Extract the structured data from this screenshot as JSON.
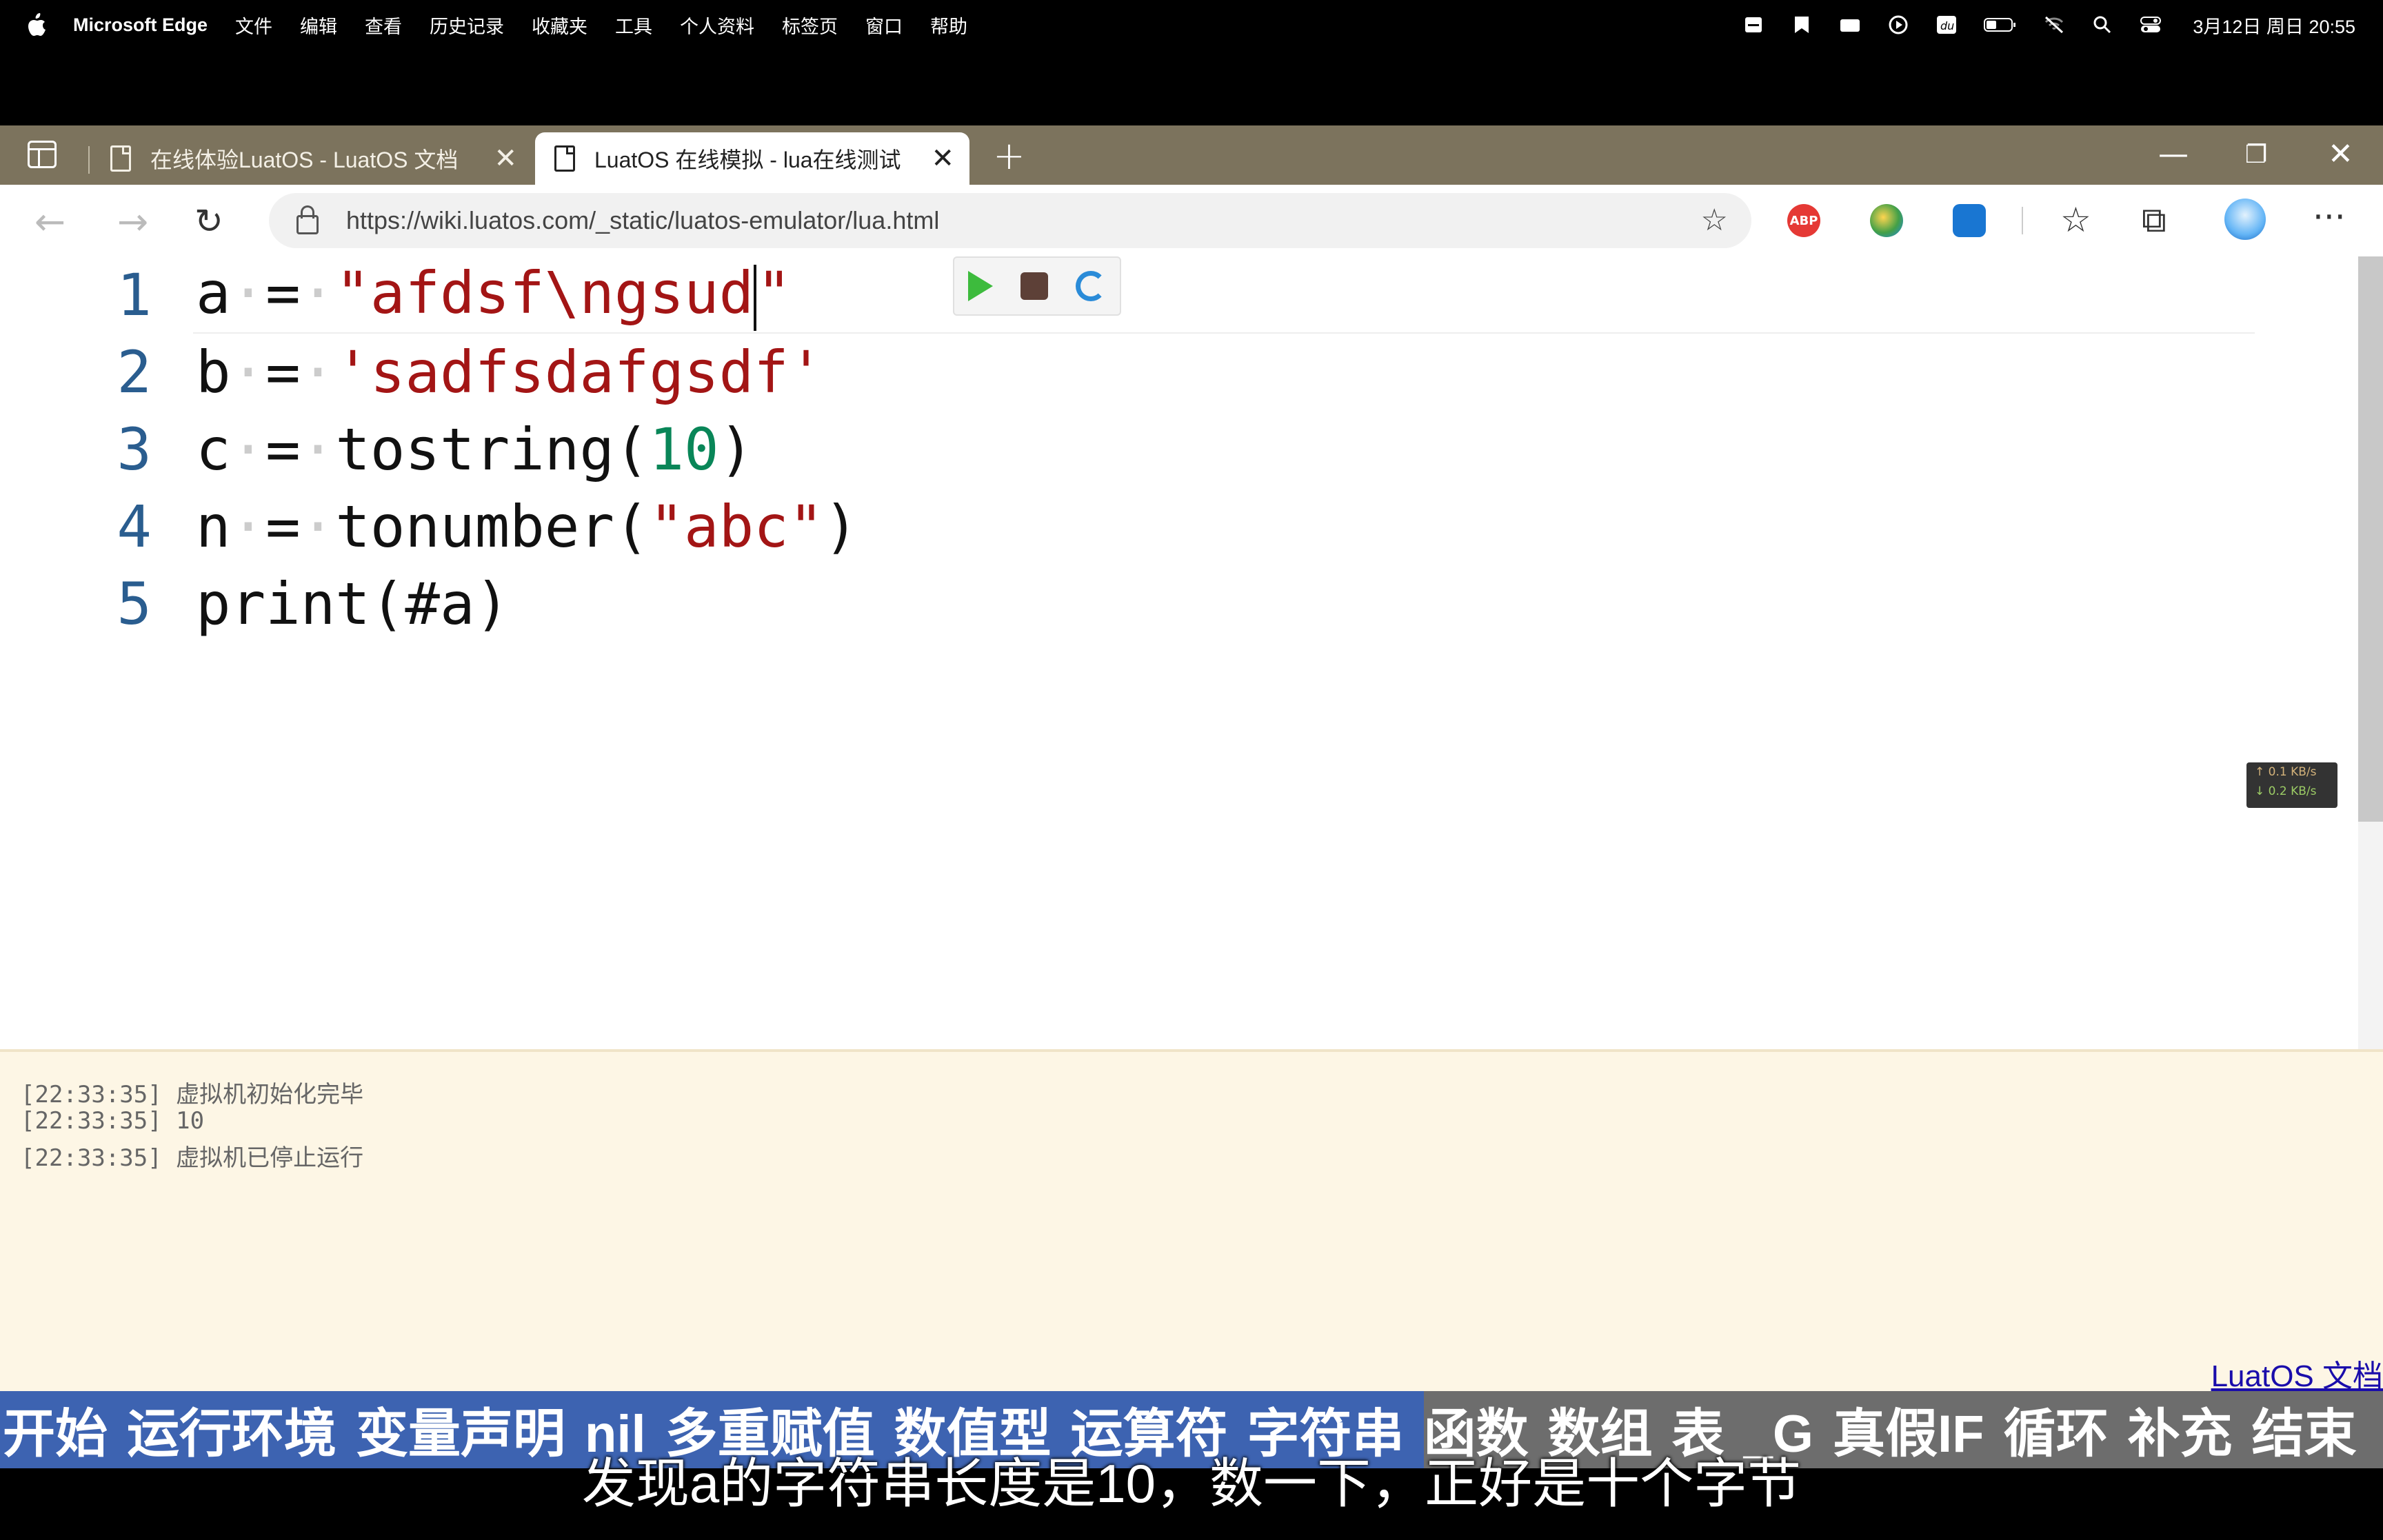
{
  "menubar": {
    "app_name": "Microsoft Edge",
    "menus": [
      "文件",
      "编辑",
      "查看",
      "历史记录",
      "收藏夹",
      "工具",
      "个人资料",
      "标签页",
      "窗口",
      "帮助"
    ],
    "clock": "3月12日 周日 20:55"
  },
  "browser": {
    "tabs": [
      {
        "title": "在线体验LuatOS - LuatOS 文档"
      },
      {
        "title": "LuatOS 在线模拟 - lua在线测试"
      }
    ],
    "url": "https://wiki.luatos.com/_static/luatos-emulator/lua.html",
    "extensions": {
      "abp": "ABP"
    }
  },
  "editor": {
    "lines": [
      {
        "n": "1"
      },
      {
        "n": "2"
      },
      {
        "n": "3"
      },
      {
        "n": "4"
      },
      {
        "n": "5"
      }
    ],
    "tokens": {
      "l1_var": "a",
      "l1_str": "\"afdsf\\ngsud",
      "l1_str_end": "\"",
      "l2_var": "b",
      "l2_str": "'sadfsdafgsdf'",
      "l3_var": "c",
      "l3_fn": "tostring(",
      "l3_num": "10",
      "l3_close": ")",
      "l4_var": "n",
      "l4_fn": "tonumber(",
      "l4_str": "\"abc\"",
      "l4_close": ")",
      "l5_code": "print(#a)",
      "op": "="
    },
    "netspeed": {
      "up": "↑ 0.1 KB/s",
      "down": "↓ 0.2 KB/s"
    }
  },
  "console": {
    "logs": [
      "[22:33:35] 虚拟机初始化完毕",
      "[22:33:35] 10",
      "[22:33:35] 虚拟机已停止运行"
    ],
    "doc_link": "LuatOS 文档"
  },
  "video": {
    "chapters_done": [
      "开始",
      "运行环境",
      "变量声明",
      "nil",
      "多重赋值",
      "数值型",
      "运算符",
      "字符串"
    ],
    "chapters_rest": [
      "函数",
      "数组",
      "表",
      "_G",
      "真假IF",
      "循环",
      "补充",
      "结束"
    ],
    "subtitle": "发现a的字符串长度是10，数一下，正好是十个字节"
  },
  "colors": {
    "tabbar": "#7c735d",
    "chapter_done": "#3d63b1",
    "console_bg": "#fdf6e5"
  }
}
